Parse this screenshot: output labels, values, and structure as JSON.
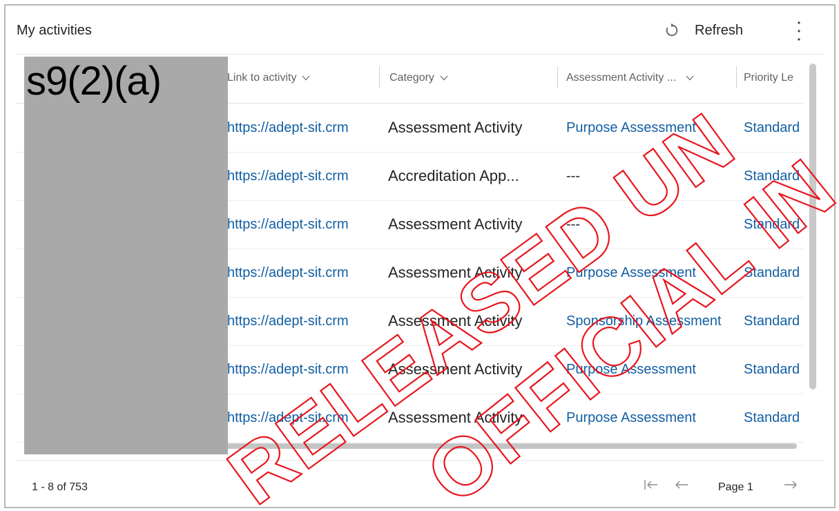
{
  "header": {
    "title": "My activities",
    "refresh_label": "Refresh",
    "refresh_icon": "refresh-icon",
    "more_icon": "more-vertical-icon"
  },
  "columns": {
    "link": "Link to activity",
    "category": "Category",
    "assessment": "Assessment Activity ...",
    "priority": "Priority Le"
  },
  "rows": [
    {
      "link": "https://adept-sit.crm",
      "category": "Assessment Activity",
      "assessment": "Purpose Assessment",
      "priority": "Standard"
    },
    {
      "link": "https://adept-sit.crm",
      "category": "Accreditation App...",
      "assessment": "---",
      "priority": "Standard"
    },
    {
      "link": "https://adept-sit.crm",
      "category": "Assessment Activity",
      "assessment": "---",
      "priority": "Standard"
    },
    {
      "link": "https://adept-sit.crm",
      "category": "Assessment Activity",
      "assessment": "Purpose Assessment",
      "priority": "Standard"
    },
    {
      "link": "https://adept-sit.crm",
      "category": "Assessment Activity",
      "assessment": "Sponsorship Assessment",
      "priority": "Standard"
    },
    {
      "link": "https://adept-sit.crm",
      "category": "Assessment Activity",
      "assessment": "Purpose Assessment",
      "priority": "Standard"
    },
    {
      "link": "https://adept-sit.crm",
      "category": "Assessment Activity",
      "assessment": "Purpose Assessment",
      "priority": "Standard"
    }
  ],
  "redaction_label": "s9(2)(a)",
  "footer": {
    "record_count": "1 - 8 of 753",
    "page_label": "Page 1",
    "first_icon": "first-page-icon",
    "prev_icon": "arrow-left-icon",
    "next_icon": "arrow-right-icon"
  },
  "watermark": {
    "line1": "RELEASED UNDER THE",
    "line2": "OFFICIAL INFORMATION ACT",
    "color": "#e8141c"
  },
  "colors": {
    "link": "#115ea3",
    "text": "#242424",
    "redaction": "#a9a9a9"
  }
}
